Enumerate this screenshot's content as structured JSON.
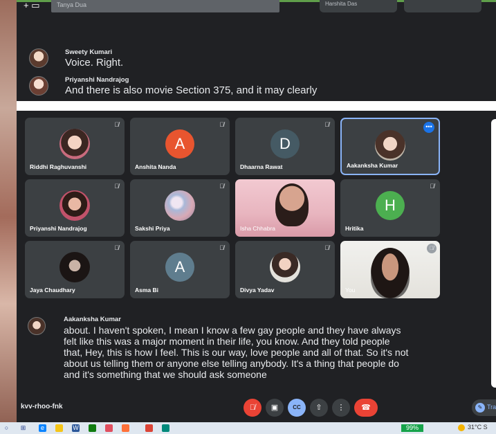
{
  "top_screenshot": {
    "input_text": "Tanya Dua",
    "tile_label": "Harshita Das",
    "captions": [
      {
        "speaker": "Sweety Kumari",
        "text": "Voice. Right."
      },
      {
        "speaker": "Priyanshi Nandrajog",
        "text": "And there is also movie Section 375, and it may clearly"
      }
    ]
  },
  "participants": [
    {
      "name": "Riddhi Raghuvanshi",
      "type": "photo"
    },
    {
      "name": "Anshita Nanda",
      "type": "letter",
      "letter": "A",
      "color": "#e8552f"
    },
    {
      "name": "Dhaarna Rawat",
      "type": "letter",
      "letter": "D",
      "color": "#455a64"
    },
    {
      "name": "Aakanksha Kumar",
      "type": "photo",
      "active": true
    },
    {
      "name": "Priyanshi Nandrajog",
      "type": "photo"
    },
    {
      "name": "Sakshi Priya",
      "type": "photo"
    },
    {
      "name": "Isha Chhabra",
      "type": "video"
    },
    {
      "name": "Hritika",
      "type": "letter",
      "letter": "H",
      "color": "#4caf50"
    },
    {
      "name": "Jaya Chaudhary",
      "type": "photo"
    },
    {
      "name": "Asma Bi",
      "type": "letter",
      "letter": "A",
      "color": "#5f7d8e"
    },
    {
      "name": "Divya Yadav",
      "type": "photo"
    },
    {
      "name": "You",
      "type": "video"
    }
  ],
  "caption": {
    "speaker": "Aakanksha Kumar",
    "lines": [
      "about. I haven't spoken, I mean I know a few gay people and they have always",
      "felt like this was a major moment in their life, you know. And they told people",
      "that, Hey, this is how I feel. This is our way, love people and all of that. So it's not",
      "about us telling them or anyone else telling anybody. It's a thing that people do",
      "and it's something that we should ask someone"
    ]
  },
  "bottom_bar": {
    "meeting_code": "kvv-rhoo-fnk",
    "cc_label": "CC",
    "translate_label": "Tra"
  },
  "taskbar": {
    "battery": "99%",
    "weather": "31°C S"
  },
  "colors": {
    "meet_bg": "#202124",
    "tile_bg": "#3c4043",
    "active_border": "#8ab4f8",
    "end_call": "#ea4335"
  }
}
